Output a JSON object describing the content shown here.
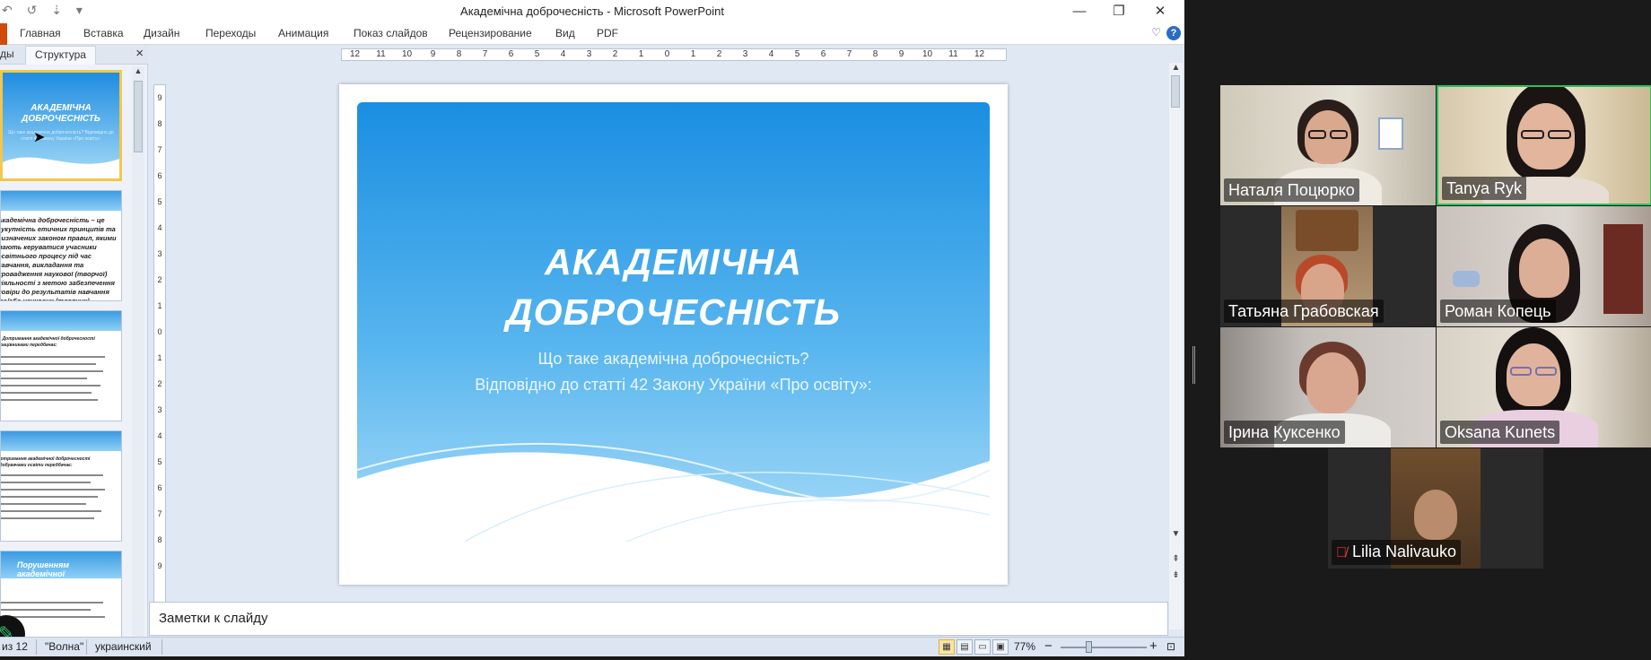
{
  "window": {
    "title": "Академічна доброчесність  -  Microsoft PowerPoint",
    "minimize": "—",
    "restore": "❐",
    "close": "✕",
    "qat": "↶ ↺ ⇣ ▾"
  },
  "ribbon": {
    "tabs": [
      "Главная",
      "Вставка",
      "Дизайн",
      "Переходы",
      "Анимация",
      "Показ слайдов",
      "Рецензирование",
      "Вид",
      "PDF"
    ],
    "help": "?",
    "collapse": "♡"
  },
  "panel": {
    "tab_slides": "ды",
    "tab_outline": "Структура",
    "close": "×"
  },
  "thumbnails": {
    "t1_title": "АКАДЕМІЧНА ДОБРОЧЕСНІСТЬ",
    "t1_sub": "Що таке академічна доброчесність? Відповідно до статті 42 Закону України «Про освіту»:",
    "t2_text": "Академічна доброчесність – це сукупність етичних принципів та визначених законом правил, якими мають керуватися учасники освітнього процесу під час навчання, викладання та провадження наукової (творчої) діяльності з метою забезпечення довіри до результатів навчання та/або наукових (творчих) досягнень.",
    "t3_title": "1. Дотримання академічної доброчесності працівниками передбачає:",
    "t4_title": "Дотримання академічної доброчесності здобувачами освіти передбачає:",
    "t5_title": "Порушенням академічної доброчесності вважається:"
  },
  "ruler": {
    "h": [
      "12",
      "11",
      "10",
      "9",
      "8",
      "7",
      "6",
      "5",
      "4",
      "3",
      "2",
      "1",
      "0",
      "1",
      "2",
      "3",
      "4",
      "5",
      "6",
      "7",
      "8",
      "9",
      "10",
      "11",
      "12"
    ],
    "v": [
      "9",
      "8",
      "7",
      "6",
      "5",
      "4",
      "3",
      "2",
      "1",
      "0",
      "1",
      "2",
      "3",
      "4",
      "5",
      "6",
      "7",
      "8",
      "9"
    ]
  },
  "slide": {
    "title_line1": "АКАДЕМІЧНА",
    "title_line2": "ДОБРОЧЕСНІСТЬ",
    "subtitle_line1": "Що таке академічна доброчесність?",
    "subtitle_line2": "Відповідно до статті 42 Закону України «Про освіту»:"
  },
  "notes": {
    "placeholder": "Заметки к слайду"
  },
  "status": {
    "slide_counter": "из 12",
    "theme": "\"Волна\"",
    "language": "украинский",
    "zoom": "77%",
    "zoom_minus": "−",
    "zoom_plus": "+"
  },
  "participants": [
    {
      "name": "Наталя Поцюрко",
      "muted": false,
      "active": false
    },
    {
      "name": "Tanya Ryk",
      "muted": false,
      "active": true
    },
    {
      "name": "Татьяна Грабовская",
      "muted": false,
      "active": false
    },
    {
      "name": "Роман Копець",
      "muted": false,
      "active": false
    },
    {
      "name": "Ірина Куксенко",
      "muted": false,
      "active": false
    },
    {
      "name": "Oksana Kunets",
      "muted": false,
      "active": false
    },
    {
      "name": "Lilia Nalivauko",
      "muted": true,
      "active": false
    }
  ],
  "colors": {
    "accent": "#1b8ee2",
    "active_speaker": "#22c55e",
    "file_tab": "#d04a0a"
  }
}
